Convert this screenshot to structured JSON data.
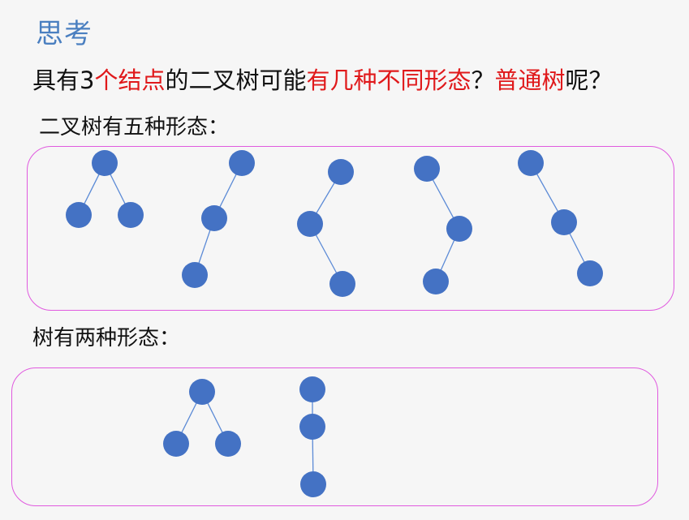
{
  "title": "思考",
  "question": {
    "parts": [
      {
        "text": "具有3",
        "color": "#111111"
      },
      {
        "text": "个结点",
        "color": "#e0191b"
      },
      {
        "text": "的二叉树可能",
        "color": "#111111"
      },
      {
        "text": "有几种不同形态",
        "color": "#e0191b"
      },
      {
        "text": "？",
        "color": "#111111"
      },
      {
        "text": "普通树",
        "color": "#e0191b"
      },
      {
        "text": "呢？",
        "color": "#111111"
      }
    ]
  },
  "binary_section": {
    "label": "二叉树有五种形态："
  },
  "tree_section": {
    "label": "树有两种形态："
  },
  "colors": {
    "title": "#4a7fc0",
    "highlight": "#e0191b",
    "node_fill": "#4472c4",
    "edge": "#5b8ad6",
    "box_border": "#e05adf"
  }
}
